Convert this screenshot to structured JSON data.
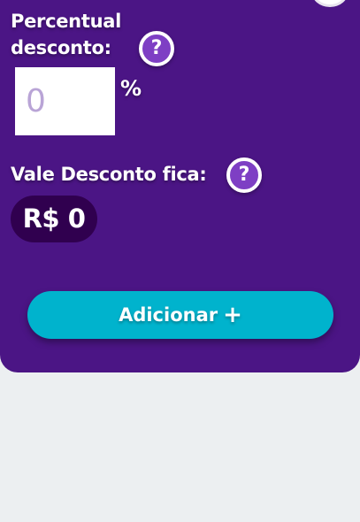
{
  "discount": {
    "label_line1": "Percentual",
    "label_line2": "desconto:",
    "input_placeholder": "0",
    "percent_sign": "%",
    "help_glyph": "?"
  },
  "voucher": {
    "label": "Vale Desconto fica:",
    "value": "R$ 0",
    "help_glyph": "?"
  },
  "actions": {
    "add_label": "Adicionar",
    "add_icon": "+"
  },
  "colors": {
    "card_bg": "#4b1585",
    "page_bg": "#eceff1",
    "help_bg": "#7e3fc4",
    "badge_bg": "#30004f",
    "button_bg": "#00b3cd"
  }
}
